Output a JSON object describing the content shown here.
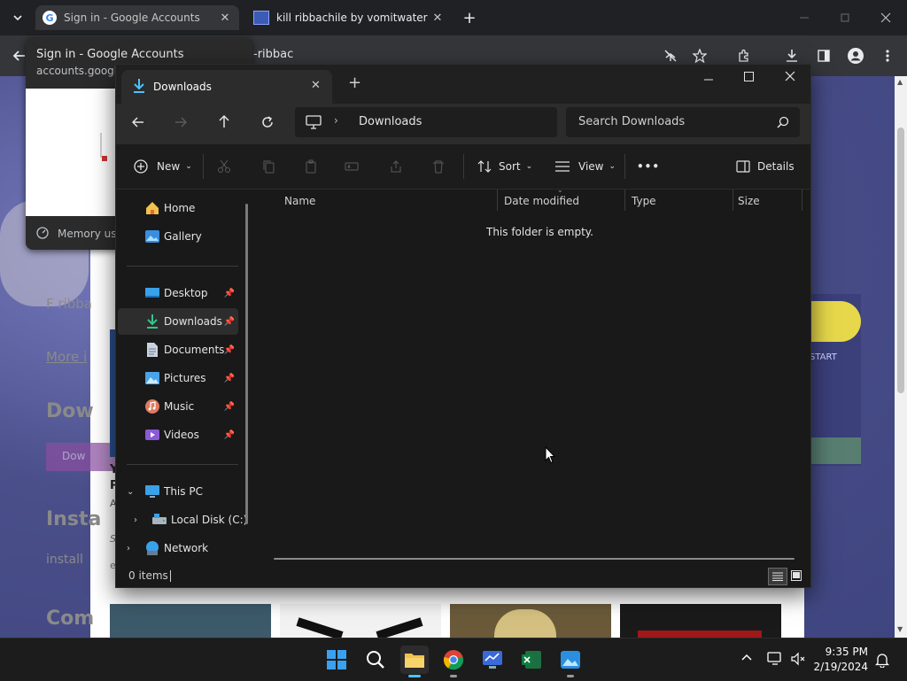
{
  "chrome": {
    "tabs": [
      {
        "title": "Sign in - Google Accounts",
        "active": false
      },
      {
        "title": "kill ribbachile by vomitwater",
        "active": true
      }
    ],
    "new_tab_label": "+",
    "address_text": "-ribbac"
  },
  "hovercard": {
    "title": "Sign in - Google Accounts",
    "domain": "accounts.google",
    "memory_label": "Memory usa"
  },
  "webpage": {
    "side_texts": [
      "F ribba",
      "More i",
      "Dow",
      "Dow",
      "Y",
      "P",
      "A",
      "Insta",
      "S",
      "install",
      "e",
      "Com"
    ],
    "start_label": "START"
  },
  "explorer": {
    "tab_title": "Downloads",
    "breadcrumb": [
      "Downloads"
    ],
    "search_placeholder": "Search Downloads",
    "commands": {
      "new": "New",
      "sort": "Sort",
      "view": "View",
      "more": "•••",
      "details": "Details"
    },
    "nav": {
      "home": "Home",
      "gallery": "Gallery",
      "quick_access": [
        {
          "label": "Desktop",
          "icon": "desktop-icon"
        },
        {
          "label": "Downloads",
          "icon": "download-icon"
        },
        {
          "label": "Documents",
          "icon": "documents-icon"
        },
        {
          "label": "Pictures",
          "icon": "pictures-icon"
        },
        {
          "label": "Music",
          "icon": "music-icon"
        },
        {
          "label": "Videos",
          "icon": "videos-icon"
        }
      ],
      "this_pc": "This PC",
      "local_disk": "Local Disk (C:)",
      "network": "Network"
    },
    "columns": [
      "Name",
      "Date modified",
      "Type",
      "Size"
    ],
    "empty_message": "This folder is empty.",
    "status": "0 items",
    "accent": "#4cc2ff"
  },
  "taskbar": {
    "time": "9:35 PM",
    "date": "2/19/2024"
  }
}
